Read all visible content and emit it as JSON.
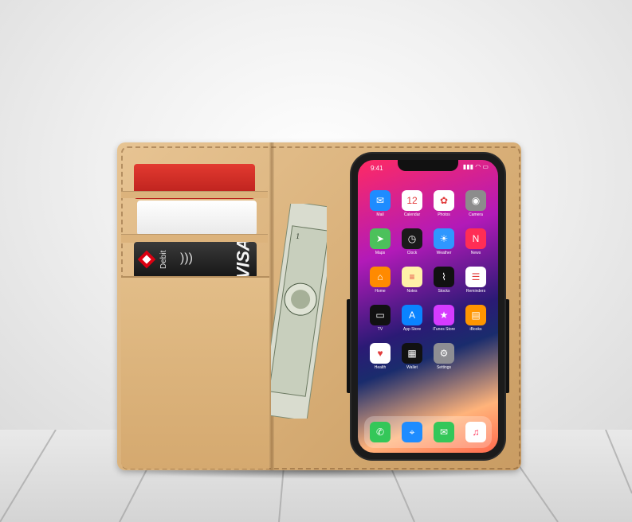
{
  "card": {
    "debit_text": "Debit",
    "brand_text": "VISA"
  },
  "phone": {
    "time": "9:41",
    "apps": [
      {
        "label": "Mail",
        "icon": "mail-icon",
        "color": "#1e8cff",
        "glyph": "✉"
      },
      {
        "label": "Calendar",
        "icon": "calendar-icon",
        "color": "#ffffff",
        "glyph": "12"
      },
      {
        "label": "Photos",
        "icon": "photos-icon",
        "color": "#ffffff",
        "glyph": "✿"
      },
      {
        "label": "Camera",
        "icon": "camera-icon",
        "color": "#8c8c8c",
        "glyph": "◉"
      },
      {
        "label": "Maps",
        "icon": "maps-icon",
        "color": "#4cc15b",
        "glyph": "➤"
      },
      {
        "label": "Clock",
        "icon": "clock-icon",
        "color": "#1a1a1a",
        "glyph": "◷"
      },
      {
        "label": "Weather",
        "icon": "weather-icon",
        "color": "#2f97ff",
        "glyph": "☀"
      },
      {
        "label": "News",
        "icon": "news-icon",
        "color": "#ff2d55",
        "glyph": "N"
      },
      {
        "label": "Home",
        "icon": "home-icon",
        "color": "#ff8a00",
        "glyph": "⌂"
      },
      {
        "label": "Notes",
        "icon": "notes-icon",
        "color": "#fff1a8",
        "glyph": "≡"
      },
      {
        "label": "Stocks",
        "icon": "stocks-icon",
        "color": "#111111",
        "glyph": "⌇"
      },
      {
        "label": "Reminders",
        "icon": "reminders-icon",
        "color": "#ffffff",
        "glyph": "☰"
      },
      {
        "label": "TV",
        "icon": "tv-icon",
        "color": "#111111",
        "glyph": "▭"
      },
      {
        "label": "App Store",
        "icon": "app-store-icon",
        "color": "#0a84ff",
        "glyph": "A"
      },
      {
        "label": "iTunes Store",
        "icon": "itunes-store-icon",
        "color": "#d63bff",
        "glyph": "★"
      },
      {
        "label": "iBooks",
        "icon": "books-icon",
        "color": "#ff9500",
        "glyph": "▤"
      },
      {
        "label": "Health",
        "icon": "health-icon",
        "color": "#ffffff",
        "glyph": "♥"
      },
      {
        "label": "Wallet",
        "icon": "wallet-icon",
        "color": "#111111",
        "glyph": "▦"
      },
      {
        "label": "Settings",
        "icon": "settings-icon",
        "color": "#8e8e93",
        "glyph": "⚙"
      }
    ],
    "dock": [
      {
        "icon": "phone-icon",
        "color": "#34c759",
        "glyph": "✆"
      },
      {
        "icon": "safari-icon",
        "color": "#1e8cff",
        "glyph": "⌖"
      },
      {
        "icon": "messages-icon",
        "color": "#34c759",
        "glyph": "✉"
      },
      {
        "icon": "music-icon",
        "color": "#ffffff",
        "glyph": "♫"
      }
    ]
  }
}
